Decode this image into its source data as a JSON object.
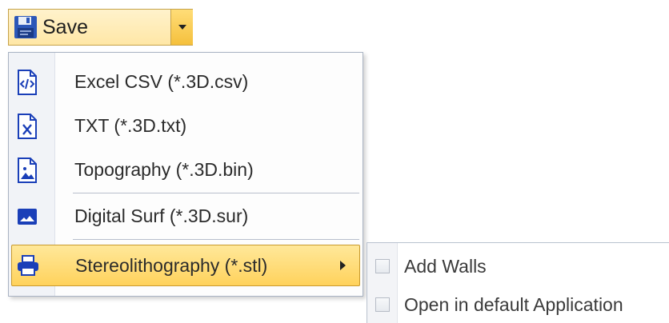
{
  "save_button": {
    "label": "Save",
    "icon": "floppy-disk-icon",
    "dropdown_icon": "chevron-down-icon"
  },
  "menu": {
    "items": [
      {
        "label": "Excel CSV (*.3D.csv)",
        "icon": "csv-file-icon"
      },
      {
        "label": "TXT (*.3D.txt)",
        "icon": "txt-file-icon"
      },
      {
        "label": "Topography (*.3D.bin)",
        "icon": "image-file-icon"
      },
      {
        "label": "Digital Surf (*.3D.sur)",
        "icon": "surface-icon"
      },
      {
        "label": "Stereolithography (*.stl)",
        "icon": "printer-icon",
        "highlighted": true,
        "has_submenu": true
      }
    ]
  },
  "submenu": {
    "items": [
      {
        "label": "Add Walls",
        "checked": false
      },
      {
        "label": "Open in default Application",
        "checked": false
      }
    ]
  },
  "colors": {
    "highlight": "#ffd25c",
    "icon_blue": "#1a3fb8",
    "border": "#a9b3c3"
  }
}
